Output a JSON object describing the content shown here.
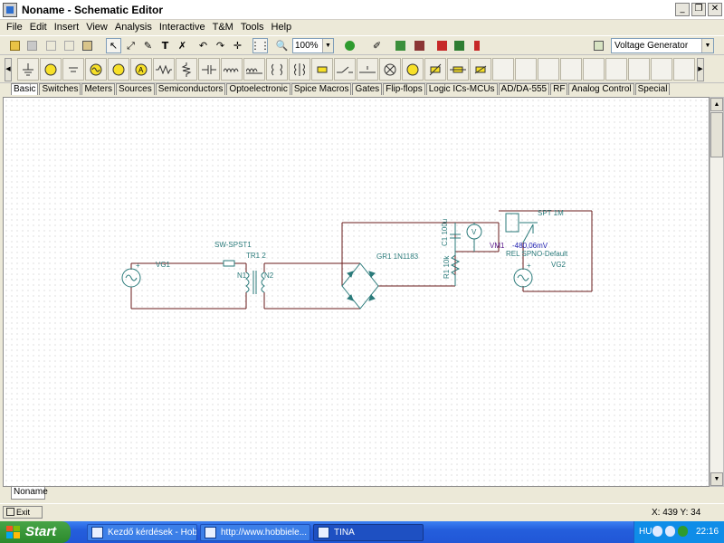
{
  "window": {
    "title": "Noname - Schematic Editor"
  },
  "menu": [
    "File",
    "Edit",
    "Insert",
    "View",
    "Analysis",
    "Interactive",
    "T&M",
    "Tools",
    "Help"
  ],
  "toolbar": {
    "zoom": "100%",
    "component_select": "Voltage Generator"
  },
  "tabs": [
    "Basic",
    "Switches",
    "Meters",
    "Sources",
    "Semiconductors",
    "Optoelectronic",
    "Spice Macros",
    "Gates",
    "Flip-flops",
    "Logic ICs-MCUs",
    "AD/DA-555",
    "RF",
    "Analog Control",
    "Special"
  ],
  "active_tab": "Basic",
  "schematic": {
    "vg1": "VG1",
    "switch": "SW-SPST1",
    "transformer": "TR1 2",
    "n1": "N1",
    "n2": "N2",
    "bridge": "GR1 1N1183",
    "cap": "C1 100u",
    "res": "R1 10k",
    "voltmeter": "VM1",
    "voltmeter_symbol": "V",
    "spt": "SPT 1M",
    "reading": "-480,06mV",
    "relay": "REL SPNO-Default",
    "vg2": "VG2",
    "plus": "+"
  },
  "sheet_tab": "Noname",
  "status": {
    "exit": "Exit",
    "coords": "X: 439  Y: 34"
  },
  "taskbar": {
    "start": "Start",
    "tasks": [
      "Kezdő kérdések - Hob...",
      "http://www.hobbiele...",
      "TINA"
    ],
    "lang": "HU",
    "clock": "22:16"
  },
  "colors": {
    "wire": "#6a1b1b",
    "component": "#2a7a7a",
    "reading": "#1d1db0",
    "taskbar": "#245edc"
  }
}
